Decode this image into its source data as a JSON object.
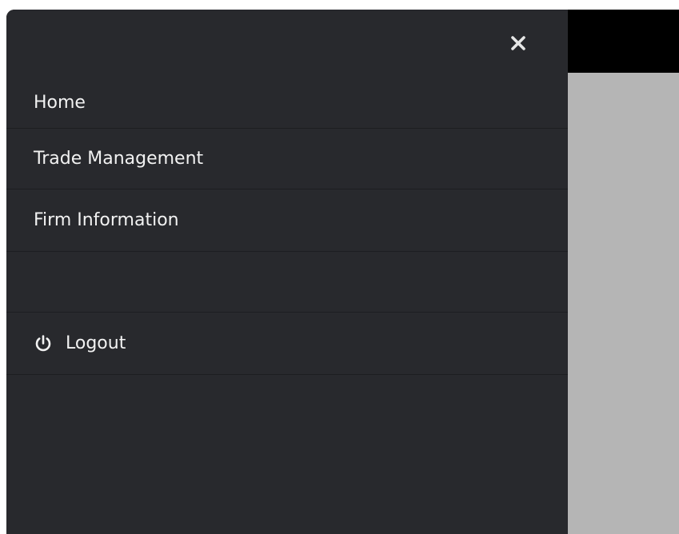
{
  "menu": {
    "items": [
      {
        "label": "Home"
      },
      {
        "label": "Trade Management"
      },
      {
        "label": "Firm Information"
      }
    ],
    "logout": {
      "label": "Logout",
      "icon": "power-icon"
    }
  },
  "close": {
    "icon": "close-icon"
  },
  "colors": {
    "drawer_bg": "#28292d",
    "topbar_bg": "#000000",
    "content_bg": "#b5b5b5",
    "text": "#f2f2f2",
    "divider": "#1d1e21"
  }
}
